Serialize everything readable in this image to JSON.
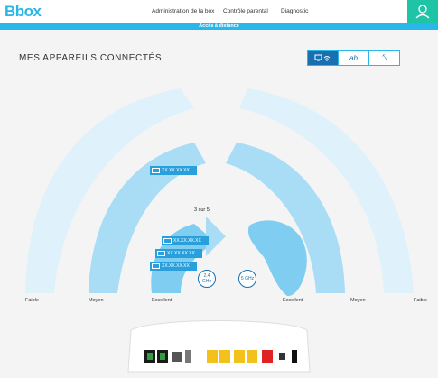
{
  "brand": "Bbox",
  "nav": [
    "Administration de la box",
    "Contrôle parental",
    "Diagnostic"
  ],
  "remote_access": "Accès à distance",
  "title": "MES APPAREILS CONNECTÉS",
  "view_toggle": {
    "active": "wifi-view",
    "third_label": "ab",
    "fourth_label": "⤡"
  },
  "signal_labels": {
    "left": [
      "Faible",
      "Moyen",
      "Excellent"
    ],
    "right": [
      "Excellent",
      "Moyen",
      "Faible"
    ]
  },
  "devices": {
    "wide": "XX.XX.XX.XX",
    "group": [
      "XX.XX.XX.XX",
      "XX.XX.XX.XX",
      "XX.XX.XX.XX"
    ]
  },
  "pager": "3 sur 5",
  "bands": {
    "left": "2,4 GHz",
    "right": "5 GHz"
  },
  "colors": {
    "brand": "#29b6e8",
    "accent": "#1fc3a5",
    "arc_light": "#dff2fc",
    "arc_mid": "#a9ddf6",
    "arc_inner": "#7fcdf0",
    "device": "#29a0dc"
  }
}
